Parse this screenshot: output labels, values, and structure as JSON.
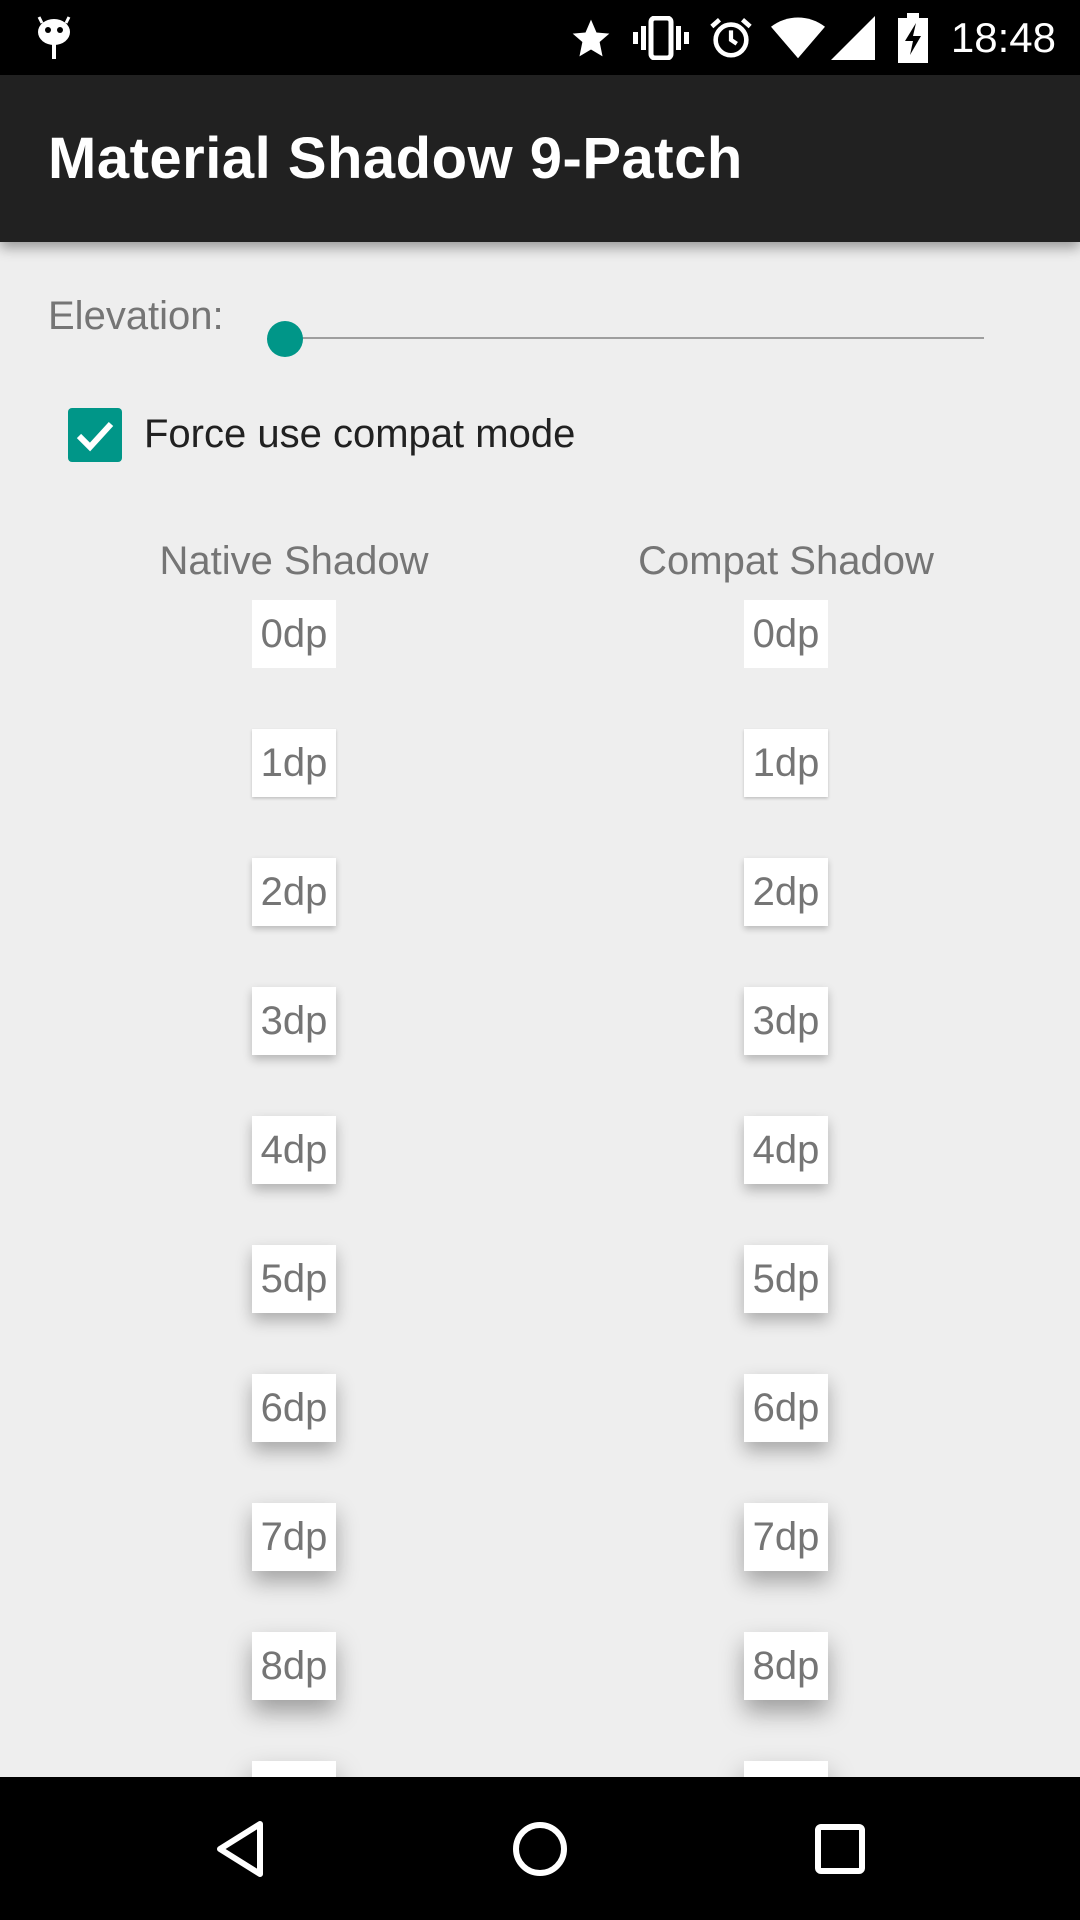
{
  "status_bar": {
    "time": "18:48",
    "icons": [
      "android-debug-icon",
      "star-icon",
      "vibrate-icon",
      "alarm-icon",
      "wifi-icon",
      "signal-icon",
      "battery-charging-icon"
    ]
  },
  "app_bar": {
    "title": "Material Shadow 9-Patch"
  },
  "elevation": {
    "label": "Elevation:",
    "value": 0
  },
  "compat_mode": {
    "label": "Force use compat mode",
    "checked": true
  },
  "columns": {
    "native_header": "Native Shadow",
    "compat_header": "Compat Shadow"
  },
  "native_cards": [
    "0dp",
    "1dp",
    "2dp",
    "3dp",
    "4dp",
    "5dp",
    "6dp",
    "7dp",
    "8dp",
    ""
  ],
  "compat_cards": [
    "0dp",
    "1dp",
    "2dp",
    "3dp",
    "4dp",
    "5dp",
    "6dp",
    "7dp",
    "8dp",
    ""
  ],
  "colors": {
    "accent": "#009688",
    "app_bar": "#212121",
    "background": "#eeeeee"
  },
  "nav_bar": {
    "buttons": [
      "back-icon",
      "home-icon",
      "recents-icon"
    ]
  }
}
